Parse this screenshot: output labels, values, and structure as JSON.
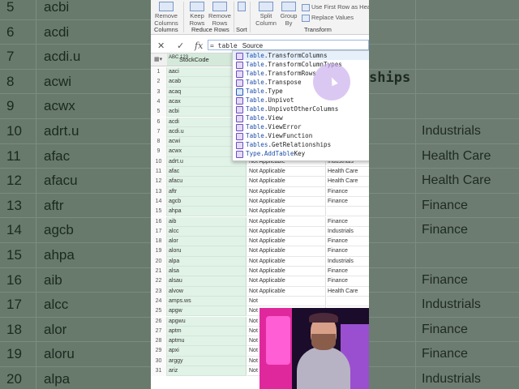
{
  "bg": {
    "rows": [
      {
        "num": "5",
        "code": "acbi",
        "ind": ""
      },
      {
        "num": "6",
        "code": "acdi",
        "ind": ""
      },
      {
        "num": "7",
        "code": "acdi.u",
        "ind": ""
      },
      {
        "num": "8",
        "code": "acwi",
        "ind": ""
      },
      {
        "num": "9",
        "code": "acwx",
        "ind": ""
      },
      {
        "num": "10",
        "code": "adrt.u",
        "ind": "Industrials"
      },
      {
        "num": "11",
        "code": "afac",
        "ind": "Health Care"
      },
      {
        "num": "12",
        "code": "afacu",
        "ind": "Health Care"
      },
      {
        "num": "13",
        "code": "aftr",
        "ind": "Finance"
      },
      {
        "num": "14",
        "code": "agcb",
        "ind": "Finance"
      },
      {
        "num": "15",
        "code": "ahpa",
        "ind": ""
      },
      {
        "num": "16",
        "code": "aib",
        "ind": "Finance"
      },
      {
        "num": "17",
        "code": "alcc",
        "ind": "Industrials"
      },
      {
        "num": "18",
        "code": "alor",
        "ind": "Finance"
      },
      {
        "num": "19",
        "code": "aloru",
        "ind": "Finance"
      },
      {
        "num": "20",
        "code": "alpa",
        "ind": "Industrials"
      }
    ],
    "fragment": "ships"
  },
  "ribbon": {
    "top_labels": [
      "Remove",
      "Keep",
      "Remove",
      "Split",
      "Group"
    ],
    "remove_columns": "Columns",
    "keep_rows": "Rows",
    "remove_rows": "Rows",
    "split_column": "Column",
    "group_by": "By",
    "first_row": "Use First Row as Headers",
    "replace_values": "Replace Values",
    "groups": {
      "manage": "Columns",
      "reduce": "Reduce Rows",
      "sort": "Sort",
      "transform": "Transform"
    }
  },
  "formula": {
    "prefix": "=",
    "typed": "table",
    "rest": "Source",
    "fx": "fx",
    "cancel": "✕",
    "commit": "✓"
  },
  "grid": {
    "header_type": "ABC 123",
    "header_label": "StockCode",
    "rows": [
      {
        "n": "1",
        "code": "aaci",
        "app": "",
        "ind": ""
      },
      {
        "n": "2",
        "code": "acab",
        "app": "",
        "ind": ""
      },
      {
        "n": "3",
        "code": "acaq",
        "app": "",
        "ind": ""
      },
      {
        "n": "4",
        "code": "acax",
        "app": "",
        "ind": ""
      },
      {
        "n": "5",
        "code": "acbi",
        "app": "",
        "ind": ""
      },
      {
        "n": "6",
        "code": "acdi",
        "app": "",
        "ind": ""
      },
      {
        "n": "7",
        "code": "acdi.u",
        "app": "",
        "ind": ""
      },
      {
        "n": "8",
        "code": "acwi",
        "app": "",
        "ind": ""
      },
      {
        "n": "9",
        "code": "acwx",
        "app": "",
        "ind": ""
      },
      {
        "n": "10",
        "code": "adrt.u",
        "app": "Not Applicable",
        "ind": "Industrials"
      },
      {
        "n": "11",
        "code": "afac",
        "app": "Not Applicable",
        "ind": "Health Care"
      },
      {
        "n": "12",
        "code": "afacu",
        "app": "Not Applicable",
        "ind": "Health Care"
      },
      {
        "n": "13",
        "code": "aftr",
        "app": "Not Applicable",
        "ind": "Finance"
      },
      {
        "n": "14",
        "code": "agcb",
        "app": "Not Applicable",
        "ind": "Finance"
      },
      {
        "n": "15",
        "code": "ahpa",
        "app": "Not Applicable",
        "ind": ""
      },
      {
        "n": "16",
        "code": "aib",
        "app": "Not Applicable",
        "ind": "Finance"
      },
      {
        "n": "17",
        "code": "alcc",
        "app": "Not Applicable",
        "ind": "Industrials"
      },
      {
        "n": "18",
        "code": "alor",
        "app": "Not Applicable",
        "ind": "Finance"
      },
      {
        "n": "19",
        "code": "aloru",
        "app": "Not Applicable",
        "ind": "Finance"
      },
      {
        "n": "20",
        "code": "alpa",
        "app": "Not Applicable",
        "ind": "Industrials"
      },
      {
        "n": "21",
        "code": "alsa",
        "app": "Not Applicable",
        "ind": "Finance"
      },
      {
        "n": "22",
        "code": "alsau",
        "app": "Not Applicable",
        "ind": "Finance"
      },
      {
        "n": "23",
        "code": "alvow",
        "app": "Not Applicable",
        "ind": "Health Care"
      },
      {
        "n": "24",
        "code": "amps.ws",
        "app": "Not",
        "ind": ""
      },
      {
        "n": "25",
        "code": "apgw",
        "app": "Not",
        "ind": ""
      },
      {
        "n": "26",
        "code": "apgwu",
        "app": "Not",
        "ind": ""
      },
      {
        "n": "27",
        "code": "aptm",
        "app": "Not",
        "ind": ""
      },
      {
        "n": "28",
        "code": "aptmu",
        "app": "Not",
        "ind": ""
      },
      {
        "n": "29",
        "code": "apxi",
        "app": "Not",
        "ind": ""
      },
      {
        "n": "30",
        "code": "arggy",
        "app": "Not",
        "ind": ""
      },
      {
        "n": "31",
        "code": "ariz",
        "app": "Not",
        "ind": ""
      }
    ]
  },
  "autocomplete": {
    "items": [
      {
        "hl": "Table",
        "rest": ".TransformColumns",
        "kind": "fn"
      },
      {
        "hl": "Table",
        "rest": ".TransformColumnTypes",
        "kind": "fn"
      },
      {
        "hl": "Table",
        "rest": ".TransformRows",
        "kind": "fn"
      },
      {
        "hl": "Table",
        "rest": ".Transpose",
        "kind": "fn"
      },
      {
        "hl": "Table",
        "rest": ".Type",
        "kind": "type"
      },
      {
        "hl": "Table",
        "rest": ".Unpivot",
        "kind": "fn"
      },
      {
        "hl": "Table",
        "rest": ".UnpivotOtherColumns",
        "kind": "fn"
      },
      {
        "hl": "Table",
        "rest": ".View",
        "kind": "fn"
      },
      {
        "hl": "Table",
        "rest": ".ViewError",
        "kind": "fn"
      },
      {
        "hl": "Table",
        "rest": ".ViewFunction",
        "kind": "fn"
      },
      {
        "hl": "Tables",
        "rest": ".GetRelationships",
        "kind": "fn"
      },
      {
        "hl": "Type.Add",
        "rest": "Table",
        "rest2": "Key",
        "kind": "fn"
      }
    ]
  }
}
